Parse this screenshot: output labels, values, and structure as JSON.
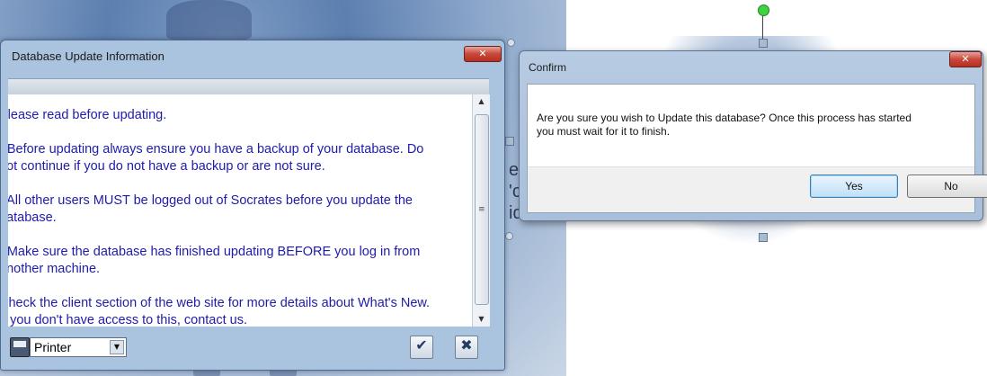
{
  "background": {
    "ghost_text": [
      "e",
      "'c",
      "id"
    ],
    "handle_marks": "o∩"
  },
  "db_window": {
    "title": "Database Update Information",
    "close_glyph": "✕",
    "lines": [
      "Please read before updating.",
      "- Before updating always ensure you have a backup of your database. Do",
      "not continue if you do not have a backup or are not sure.",
      "- All other users MUST be logged out of Socrates before you update the",
      "database.",
      "- Make sure the database has finished updating BEFORE you log in from",
      "another machine.",
      "Check the client section of the web site for more details about What's New.",
      "If you don't have access to this, contact us."
    ],
    "scroll_up_glyph": "▲",
    "scroll_down_glyph": "▼",
    "scroll_grip_glyph": "≡",
    "printer_select_value": "Printer",
    "dropdown_glyph": "▼",
    "ok_glyph": "✔",
    "cancel_glyph": "✖"
  },
  "confirm_dialog": {
    "title": "Confirm",
    "close_glyph": "✕",
    "message_lines": [
      "Are you sure you wish to Update this database? Once this process has started",
      "you must wait for it to finish."
    ],
    "yes_label": "Yes",
    "no_label": "No"
  },
  "icons": {
    "printer": "printer-icon",
    "ok": "checkmark-icon",
    "cancel": "x-icon",
    "close": "close-icon"
  }
}
